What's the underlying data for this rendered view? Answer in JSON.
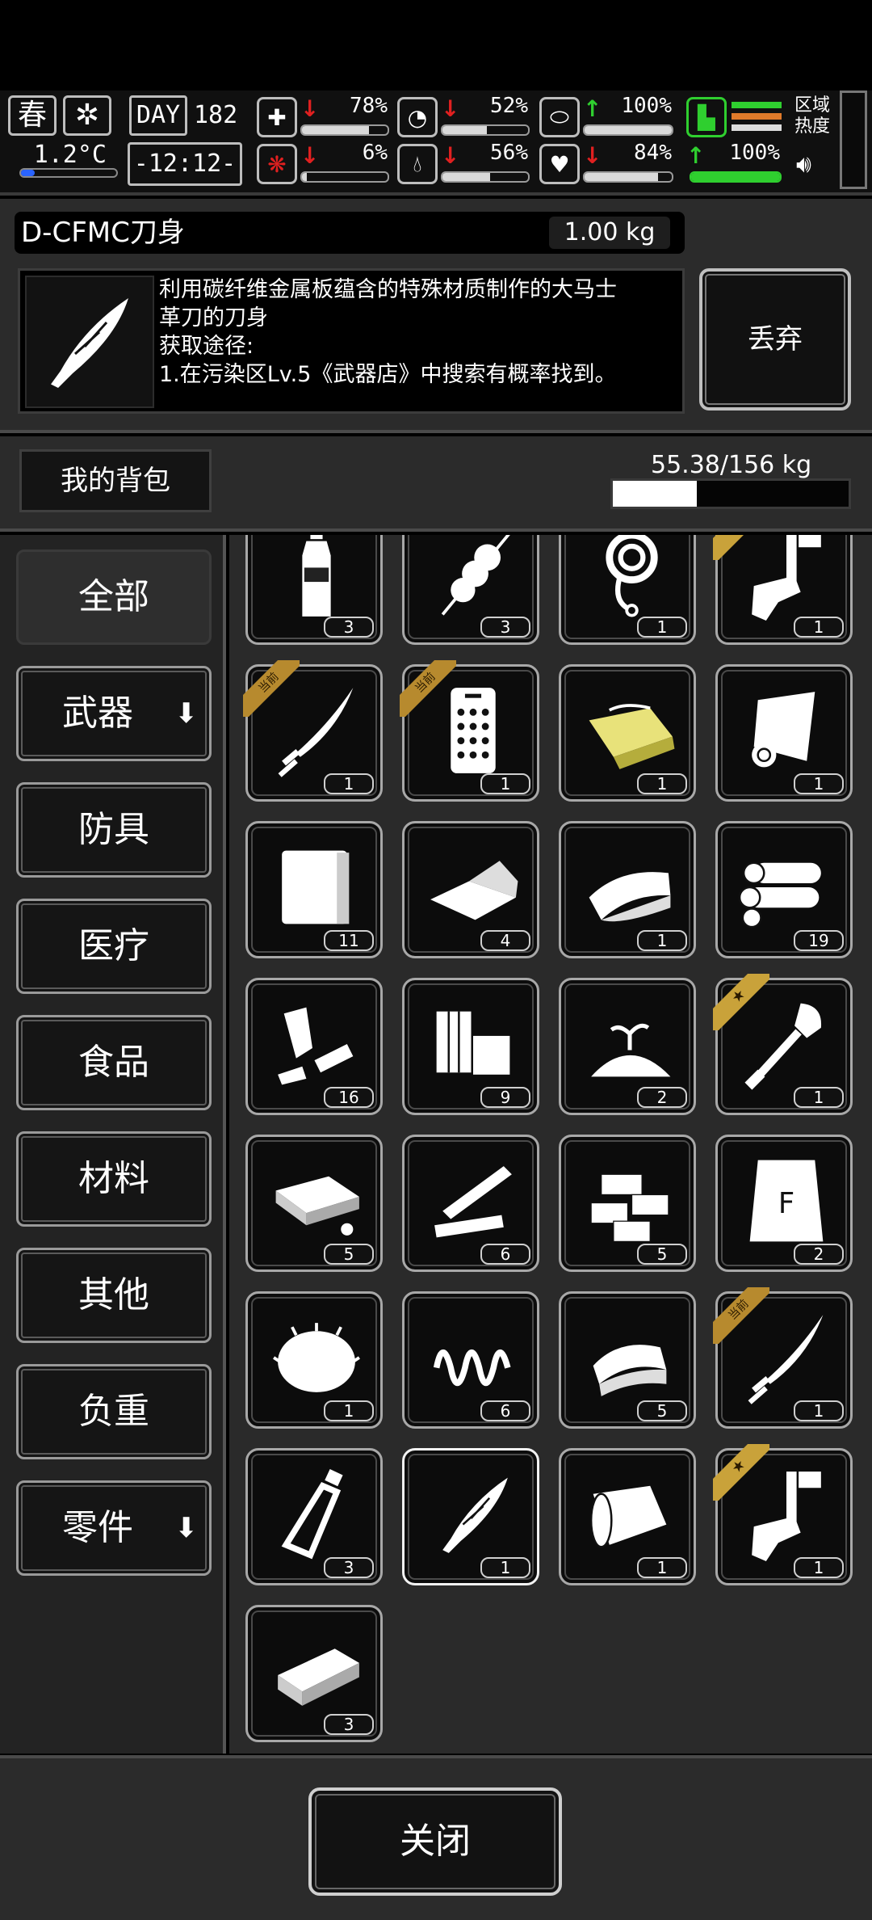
{
  "status": {
    "season": "春",
    "weather_icon": "snowflake-icon",
    "temperature": "1.2°C",
    "day_label": "DAY",
    "day_number": "182",
    "time": "-12:12-",
    "stats": [
      {
        "name": "health",
        "icon": "medkit-icon",
        "trend": "↓",
        "value": "78%",
        "fill": 0.78,
        "color": "#d9d9d9"
      },
      {
        "name": "hunger",
        "icon": "stomach-icon",
        "trend": "↓",
        "value": "52%",
        "fill": 0.52,
        "color": "#d9d9d9"
      },
      {
        "name": "energy",
        "icon": "capsule-icon",
        "trend": "↑",
        "value": "100%",
        "fill": 1.0,
        "color": "#d9d9d9"
      },
      {
        "name": "infection",
        "icon": "brain-icon",
        "trend": "↓",
        "value": "6%",
        "fill": 0.06,
        "color": "#d9d9d9"
      },
      {
        "name": "thirst",
        "icon": "water-drop-icon",
        "trend": "↓",
        "value": "56%",
        "fill": 0.56,
        "color": "#d9d9d9"
      },
      {
        "name": "mood",
        "icon": "heart-icon",
        "trend": "↓",
        "value": "84%",
        "fill": 0.84,
        "color": "#d9d9d9"
      },
      {
        "name": "stamina",
        "icon": "boot-icon",
        "trend": "↑",
        "value": "100%",
        "fill": 1.0,
        "color": "#2fcf2f"
      }
    ],
    "region_label": "区域热度",
    "sound_icon": "speaker-icon"
  },
  "detail": {
    "name": "D-CFMC刀身",
    "weight": "1.00 kg",
    "description": "利用碳纤维金属板蕴含的特殊材质制作的大马士\n革刀的刀身\n获取途径:\n1.在污染区Lv.5《武器店》中搜索有概率找到。",
    "discard_label": "丢弃"
  },
  "bag": {
    "title": "我的背包",
    "capacity": "55.38/156 kg",
    "load_fraction": 0.355
  },
  "categories": [
    {
      "label": "全部",
      "active": true,
      "arrow": false
    },
    {
      "label": "武器",
      "active": false,
      "arrow": true
    },
    {
      "label": "防具",
      "active": false,
      "arrow": false
    },
    {
      "label": "医疗",
      "active": false,
      "arrow": false
    },
    {
      "label": "食品",
      "active": false,
      "arrow": false
    },
    {
      "label": "材料",
      "active": false,
      "arrow": false
    },
    {
      "label": "其他",
      "active": false,
      "arrow": false
    },
    {
      "label": "负重",
      "active": false,
      "arrow": false
    },
    {
      "label": "零件",
      "active": false,
      "arrow": true
    }
  ],
  "badge_text": "当前",
  "items": [
    {
      "icon": "water-bottle-icon",
      "qty": "3",
      "badge": ""
    },
    {
      "icon": "skewer-icon",
      "qty": "3",
      "badge": ""
    },
    {
      "icon": "rope-icon",
      "qty": "1",
      "badge": ""
    },
    {
      "icon": "caliper-icon",
      "qty": "1",
      "badge": "star"
    },
    {
      "icon": "katana-icon",
      "qty": "1",
      "badge": "current"
    },
    {
      "icon": "phone-panel-icon",
      "qty": "1",
      "badge": "current"
    },
    {
      "icon": "yellow-cloth-icon",
      "qty": "1",
      "badge": ""
    },
    {
      "icon": "paper-roll-icon",
      "qty": "1",
      "badge": ""
    },
    {
      "icon": "towel-icon",
      "qty": "11",
      "badge": ""
    },
    {
      "icon": "folded-cloth-icon",
      "qty": "4",
      "badge": ""
    },
    {
      "icon": "fabric-icon",
      "qty": "1",
      "badge": ""
    },
    {
      "icon": "log-pile-icon",
      "qty": "19",
      "badge": ""
    },
    {
      "icon": "scrap-metal-icon",
      "qty": "16",
      "badge": ""
    },
    {
      "icon": "wood-block-icon",
      "qty": "9",
      "badge": ""
    },
    {
      "icon": "soil-sprout-icon",
      "qty": "2",
      "badge": ""
    },
    {
      "icon": "shovel-icon",
      "qty": "1",
      "badge": "star"
    },
    {
      "icon": "stone-slab-icon",
      "qty": "5",
      "badge": ""
    },
    {
      "icon": "wood-planks-icon",
      "qty": "6",
      "badge": ""
    },
    {
      "icon": "bricks-icon",
      "qty": "5",
      "badge": ""
    },
    {
      "icon": "flour-bag-icon",
      "qty": "2",
      "badge": ""
    },
    {
      "icon": "fiber-ball-icon",
      "qty": "1",
      "badge": ""
    },
    {
      "icon": "spring-icon",
      "qty": "6",
      "badge": ""
    },
    {
      "icon": "cloth-stack-icon",
      "qty": "5",
      "badge": ""
    },
    {
      "icon": "katana-icon",
      "qty": "1",
      "badge": "current"
    },
    {
      "icon": "glass-bottle-icon",
      "qty": "3",
      "badge": ""
    },
    {
      "icon": "blade-icon",
      "qty": "1",
      "badge": "",
      "selected": true
    },
    {
      "icon": "bandage-icon",
      "qty": "1",
      "badge": ""
    },
    {
      "icon": "caliper-icon",
      "qty": "1",
      "badge": "star"
    },
    {
      "icon": "ingot-icon",
      "qty": "3",
      "badge": ""
    }
  ],
  "close_label": "关闭"
}
